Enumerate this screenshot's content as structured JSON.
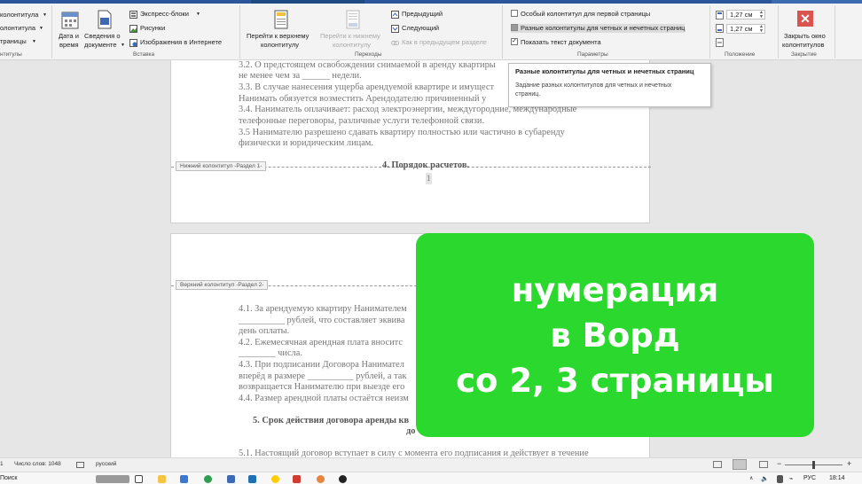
{
  "ribbon": {
    "group1": {
      "items": [
        "колонтитула",
        "олонтитула",
        "траницы"
      ],
      "label": "нтитулы"
    },
    "insert": {
      "date_time": [
        "Дата и",
        "время"
      ],
      "doc_info": [
        "Сведения о",
        "документе"
      ],
      "quick_parts": "Экспресс-блоки",
      "pictures": "Рисунки",
      "online_pictures": "Изображения в Интернете",
      "label": "Вставка"
    },
    "navigation": {
      "goto_header": [
        "Перейти к верхнему",
        "колонтитулу"
      ],
      "goto_footer": [
        "Перейти к нижнему",
        "колонтитулу"
      ],
      "previous": "Предыдущий",
      "next": "Следующий",
      "link_previous": "Как в предыдущем разделе",
      "label": "Переходы"
    },
    "options": {
      "different_first": "Особый колонтитул для первой страницы",
      "different_odd_even": "Разные колонтитулы для четных и нечетных страниц",
      "show_text": "Показать текст документа",
      "label": "Параметры"
    },
    "position": {
      "header_value": "1,27 см",
      "footer_value": "1,27 см",
      "label": "Положение"
    },
    "close": {
      "button": [
        "Закрыть окно",
        "колонтитулов"
      ],
      "label": "Закрытие"
    }
  },
  "tooltip": {
    "title": "Разные колонтитулы для четных и нечетных страниц",
    "desc_line1": "Задание разных колонтитулов для четных и нечетных",
    "desc_line2": "страниц."
  },
  "page1": {
    "lines": [
      "3.2. О предстоящем освобождении снимаемой в аренду квартиры",
      "не менее чем за ______ недели.",
      "3.3. В случае нанесения ущерба арендуемой квартире и имущест",
      "Нанимать обязуется возместить Арендодателю причиненный у",
      "3.4. Наниматель оплачивает: расход электроэнергии, междугородние, международные",
      "телефонные переговоры, различные услуги телефонной связи.",
      "3.5 Нанимателю разрешено сдавать квартиру полностью или частично в субаренду",
      "физически и юридическим лицам."
    ],
    "footer_tag": "Нижний колонтитул -Раздел 1-",
    "heading": "4. Порядок расчетов.",
    "page_number": "1"
  },
  "page2": {
    "header_tag": "Верхний колонтитул -Раздел 2-",
    "lines": [
      "4.1. За арендуемую квартиру Нанимателем",
      "__________ рублей, что составляет эквива",
      "день оплаты.",
      "4.2. Ежемесячная арендная плата вноситс",
      "________ числа.",
      "4.3. При подписании Договора Нанимател",
      "вперёд в размере __________ рублей, а так",
      "возвращается Нанимателю при выезде его",
      "4.4. Размер арендной платы остаётся неизм"
    ],
    "heading_line1": "5. Срок действия договора аренды кв",
    "heading_line2": "до",
    "bottom_line": "5.1. Настоящий договор вступает в силу с момента его подписания и действует в течение"
  },
  "promo": {
    "lines": [
      "нумерация",
      "в Ворд",
      "со 2, 3 страницы"
    ]
  },
  "statusbar": {
    "page": "1",
    "word_count": "Число слов: 1048",
    "language": "русский"
  },
  "taskbar": {
    "search": "Поиск",
    "lang": "РУС",
    "time": "18:14"
  },
  "colors": {
    "ribbon_blue": "#2b579a",
    "close_red": "#d9534f",
    "promo_green": "#2bd92e"
  }
}
